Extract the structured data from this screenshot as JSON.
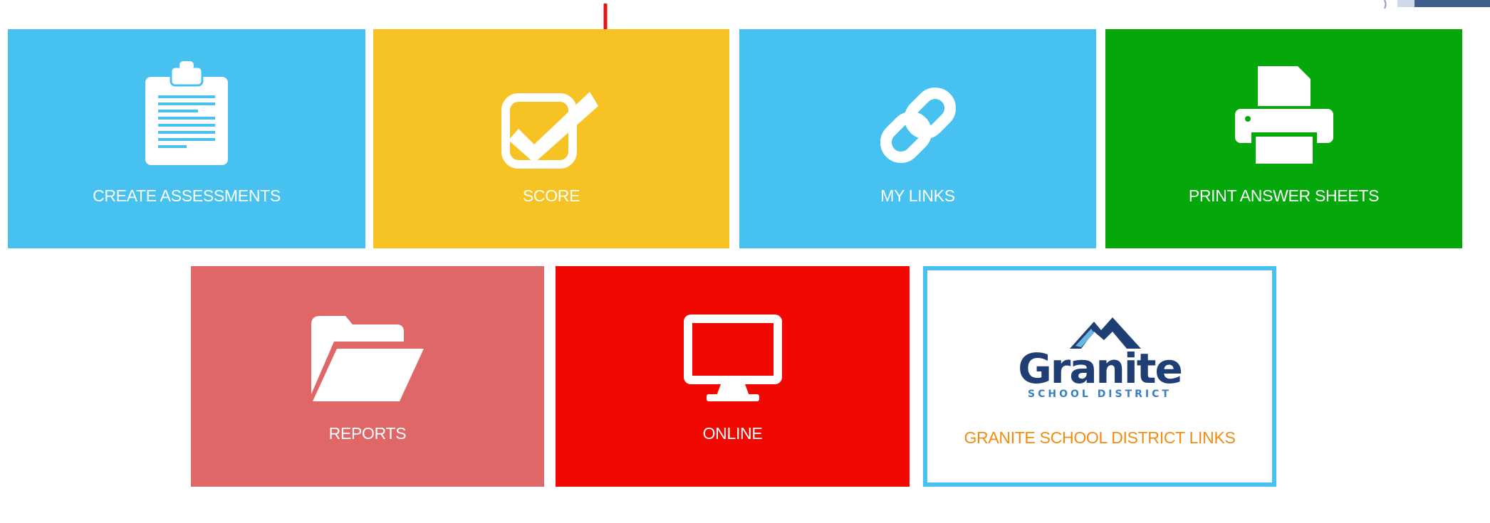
{
  "tiles": {
    "create_assessments": {
      "label": "CREATE ASSESSMENTS",
      "icon": "clipboard-icon",
      "color": "#47c2f0"
    },
    "score": {
      "label": "SCORE",
      "icon": "checkbox-icon",
      "color": "#f6c224"
    },
    "my_links": {
      "label": "MY LINKS",
      "icon": "link-icon",
      "color": "#47c2f0"
    },
    "print_answer_sheets": {
      "label": "PRINT ANSWER SHEETS",
      "icon": "printer-icon",
      "color": "#04a80a"
    },
    "reports": {
      "label": "REPORTS",
      "icon": "folder-icon",
      "color": "#e06767"
    },
    "online": {
      "label": "ONLINE",
      "icon": "monitor-icon",
      "color": "#f10800"
    },
    "granite": {
      "label": "GRANITE SCHOOL DISTRICT LINKS",
      "label_color": "#f28c0f",
      "logo": {
        "name": "Granite",
        "subtitle": "SCHOOL DISTRICT"
      }
    }
  },
  "annotation": {
    "icon": "red-arrow-icon",
    "color": "#e01515"
  }
}
